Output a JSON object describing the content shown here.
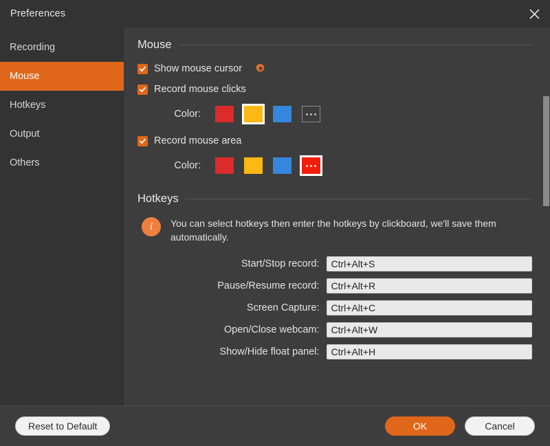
{
  "window": {
    "title": "Preferences",
    "close_icon": "close-icon"
  },
  "sidebar": {
    "items": [
      {
        "label": "Recording",
        "active": false
      },
      {
        "label": "Mouse",
        "active": true
      },
      {
        "label": "Hotkeys",
        "active": false
      },
      {
        "label": "Output",
        "active": false
      },
      {
        "label": "Others",
        "active": false
      }
    ]
  },
  "mouse_section": {
    "title": "Mouse",
    "show_cursor": {
      "label": "Show mouse cursor",
      "checked": true,
      "gear_icon": "gear-icon"
    },
    "record_clicks": {
      "label": "Record mouse clicks",
      "checked": true
    },
    "clicks_color": {
      "label": "Color:",
      "swatches": [
        {
          "name": "red",
          "color": "#dc2b2b",
          "selected": false,
          "custom": false
        },
        {
          "name": "yellow",
          "color": "#fcb813",
          "selected": true,
          "custom": false
        },
        {
          "name": "blue",
          "color": "#3586dd",
          "selected": false,
          "custom": false
        },
        {
          "name": "custom",
          "color": "#3d3d3d",
          "selected": false,
          "custom": true
        }
      ]
    },
    "record_area": {
      "label": "Record mouse area",
      "checked": true
    },
    "area_color": {
      "label": "Color:",
      "swatches": [
        {
          "name": "red",
          "color": "#dc2b2b",
          "selected": false,
          "custom": false
        },
        {
          "name": "yellow",
          "color": "#fcb813",
          "selected": false,
          "custom": false
        },
        {
          "name": "blue",
          "color": "#3586dd",
          "selected": false,
          "custom": false
        },
        {
          "name": "custom",
          "color": "#f41c0c",
          "selected": true,
          "custom": true
        }
      ]
    }
  },
  "hotkeys_section": {
    "title": "Hotkeys",
    "info_icon": "info-icon",
    "info_text": "You can select hotkeys then enter the hotkeys by clickboard, we'll save them automatically.",
    "rows": [
      {
        "label": "Start/Stop record:",
        "value": "Ctrl+Alt+S",
        "placeholder": ""
      },
      {
        "label": "Pause/Resume record:",
        "value": "Ctrl+Alt+R",
        "placeholder": ""
      },
      {
        "label": "Screen Capture:",
        "value": "Ctrl+Alt+C",
        "placeholder": ""
      },
      {
        "label": "Open/Close webcam:",
        "value": "Ctrl+Alt+W",
        "placeholder": ""
      },
      {
        "label": "Show/Hide float panel:",
        "value": "Ctrl+Alt+H",
        "placeholder": ""
      }
    ]
  },
  "footer": {
    "reset_label": "Reset to Default",
    "ok_label": "OK",
    "cancel_label": "Cancel"
  },
  "colors": {
    "accent": "#e0671a",
    "sidebar_bg": "#333333",
    "content_bg": "#3d3d3d",
    "input_bg": "#e9e9e9"
  }
}
